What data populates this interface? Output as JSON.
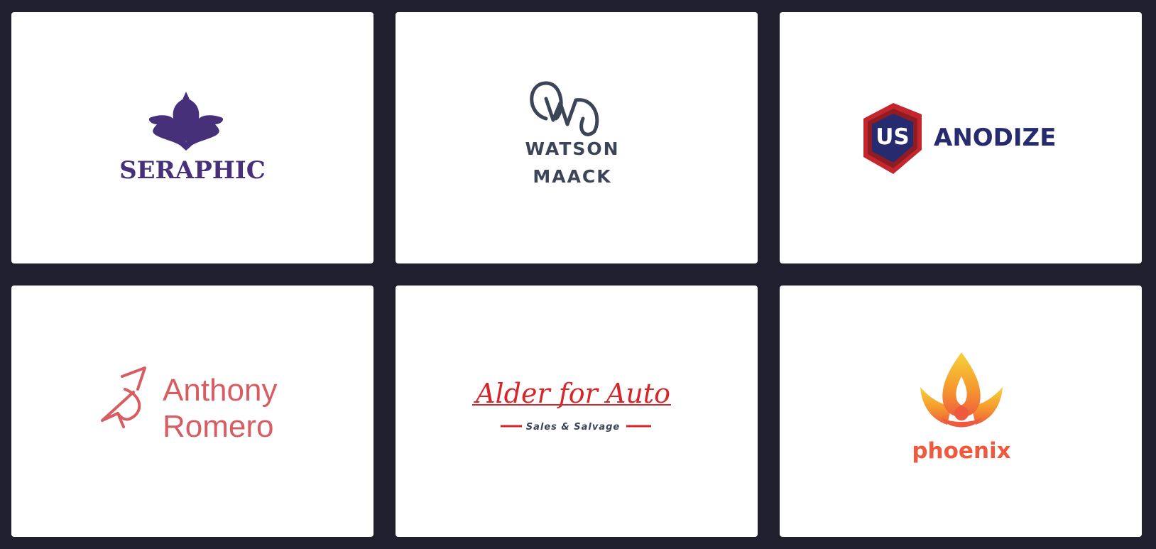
{
  "logos": [
    {
      "name": "SERAPHIC",
      "color": "#47307a"
    },
    {
      "line1": "WATSON",
      "line2": "MAACK",
      "monogram": "WM",
      "color": "#3c4458"
    },
    {
      "badge": "US",
      "name": "ANODIZE",
      "color": "#262a6e",
      "accent": "#c4262e"
    },
    {
      "line1": "Anthony",
      "line2": "Romero",
      "color": "#d75d62"
    },
    {
      "name": "Alder for Auto",
      "tagline": "Sales & Salvage",
      "color": "#d7262a"
    },
    {
      "name": "phoenix",
      "color": "#ef5a3e"
    }
  ]
}
